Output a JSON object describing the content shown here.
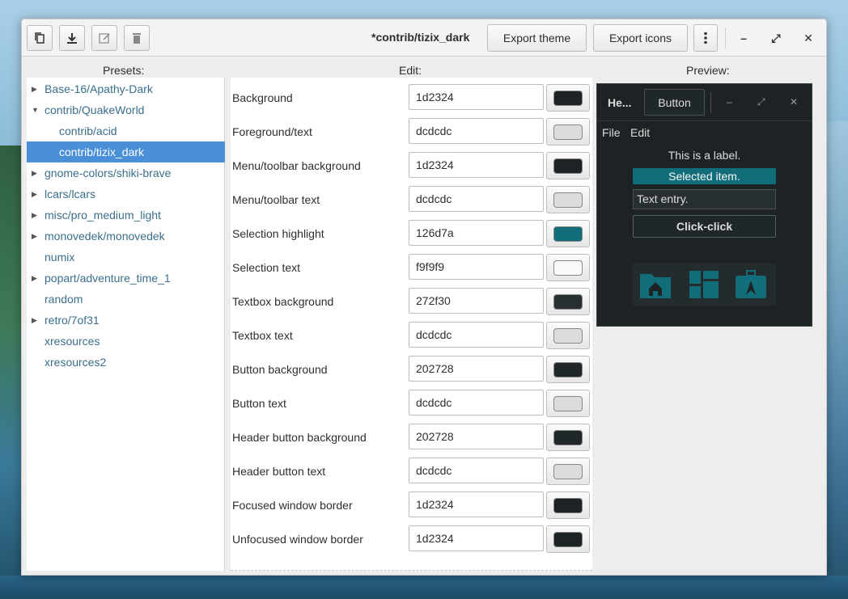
{
  "headerbar": {
    "title": "*contrib/tizix_dark",
    "buttons": {
      "copy_icon": "copy-icon",
      "download_icon": "download-icon",
      "edit_icon": "edit-icon",
      "delete_icon": "trash-icon"
    },
    "export_theme_label": "Export theme",
    "export_icons_label": "Export icons",
    "menu_icon": "kebab-menu-icon",
    "minimize_glyph": "–",
    "maximize_glyph": "⤢",
    "close_glyph": "✕"
  },
  "columns": {
    "presets_label": "Presets:",
    "edit_label": "Edit:",
    "preview_label": "Preview:"
  },
  "presets": [
    {
      "label": "Base-16/Apathy-Dark",
      "expandable": true,
      "expanded": false,
      "indent": 0,
      "selected": false
    },
    {
      "label": "contrib/QuakeWorld",
      "expandable": true,
      "expanded": true,
      "indent": 0,
      "selected": false
    },
    {
      "label": "contrib/acid",
      "expandable": false,
      "indent": 1,
      "selected": false
    },
    {
      "label": "contrib/tizix_dark",
      "expandable": false,
      "indent": 1,
      "selected": true
    },
    {
      "label": "gnome-colors/shiki-brave",
      "expandable": true,
      "expanded": false,
      "indent": 0,
      "selected": false
    },
    {
      "label": "lcars/lcars",
      "expandable": true,
      "expanded": false,
      "indent": 0,
      "selected": false
    },
    {
      "label": "misc/pro_medium_light",
      "expandable": true,
      "expanded": false,
      "indent": 0,
      "selected": false
    },
    {
      "label": "monovedek/monovedek",
      "expandable": true,
      "expanded": false,
      "indent": 0,
      "selected": false
    },
    {
      "label": "numix",
      "expandable": false,
      "indent": 0,
      "selected": false
    },
    {
      "label": "popart/adventure_time_1",
      "expandable": true,
      "expanded": false,
      "indent": 0,
      "selected": false
    },
    {
      "label": "random",
      "expandable": false,
      "indent": 0,
      "selected": false
    },
    {
      "label": "retro/7of31",
      "expandable": true,
      "expanded": false,
      "indent": 0,
      "selected": false
    },
    {
      "label": "xresources",
      "expandable": false,
      "indent": 0,
      "selected": false
    },
    {
      "label": "xresources2",
      "expandable": false,
      "indent": 0,
      "selected": false
    }
  ],
  "edit_rows": [
    {
      "label": "Background",
      "value": "1d2324",
      "color": "#1d2324"
    },
    {
      "label": "Foreground/text",
      "value": "dcdcdc",
      "color": "#dcdcdc"
    },
    {
      "label": "Menu/toolbar background",
      "value": "1d2324",
      "color": "#1d2324"
    },
    {
      "label": "Menu/toolbar text",
      "value": "dcdcdc",
      "color": "#dcdcdc"
    },
    {
      "label": "Selection highlight",
      "value": "126d7a",
      "color": "#126d7a"
    },
    {
      "label": "Selection text",
      "value": "f9f9f9",
      "color": "#f9f9f9"
    },
    {
      "label": "Textbox background",
      "value": "272f30",
      "color": "#272f30"
    },
    {
      "label": "Textbox text",
      "value": "dcdcdc",
      "color": "#dcdcdc"
    },
    {
      "label": "Button background",
      "value": "202728",
      "color": "#202728"
    },
    {
      "label": "Button text",
      "value": "dcdcdc",
      "color": "#dcdcdc"
    },
    {
      "label": "Header button background",
      "value": "202728",
      "color": "#202728"
    },
    {
      "label": "Header button text",
      "value": "dcdcdc",
      "color": "#dcdcdc"
    },
    {
      "label": "Focused window border",
      "value": "1d2324",
      "color": "#1d2324"
    },
    {
      "label": "Unfocused window border",
      "value": "1d2324",
      "color": "#1d2324"
    }
  ],
  "preview": {
    "header_title": "He...",
    "header_button": "Button",
    "minimize_glyph": "–",
    "maximize_glyph": "⤢",
    "close_glyph": "✕",
    "menu_file": "File",
    "menu_edit": "Edit",
    "label": "This is a label.",
    "selected_item": "Selected item.",
    "text_entry": "Text entry.",
    "click_button": "Click-click",
    "icon_color": "#126d7a",
    "icons": [
      "folder-home-icon",
      "dashboard-icon",
      "briefcase-icon"
    ]
  },
  "colors": {
    "accent": "#4a90d9"
  }
}
